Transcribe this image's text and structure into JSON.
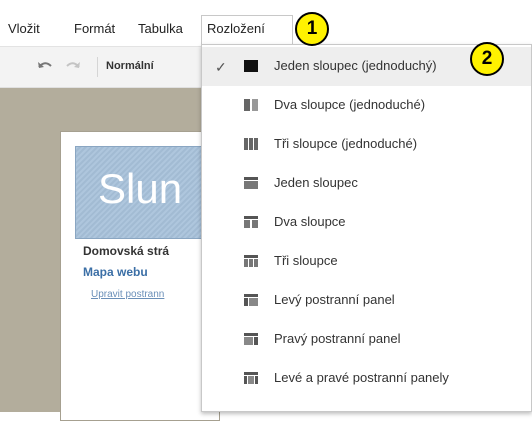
{
  "menubar": {
    "items": [
      {
        "label": "Vložit"
      },
      {
        "label": "Formát"
      },
      {
        "label": "Tabulka"
      },
      {
        "label": "Rozložení"
      }
    ]
  },
  "toolbar": {
    "undo_icon": "undo-icon",
    "redo_icon": "redo-icon",
    "style_value": "Normální"
  },
  "page": {
    "header_title": "Slun",
    "nav_home": "Domovská strá",
    "nav_sitemap": "Mapa webu",
    "nav_edit": "Upravit postrann"
  },
  "layout_menu": {
    "options": [
      {
        "label": "Jeden sloupec (jednoduchý)",
        "icon": "single-column-simple-icon",
        "checked": true
      },
      {
        "label": "Dva sloupce (jednoduché)",
        "icon": "two-columns-simple-icon",
        "checked": false
      },
      {
        "label": "Tři sloupce (jednoduché)",
        "icon": "three-columns-simple-icon",
        "checked": false
      },
      {
        "label": "Jeden sloupec",
        "icon": "single-column-icon",
        "checked": false
      },
      {
        "label": "Dva sloupce",
        "icon": "two-columns-icon",
        "checked": false
      },
      {
        "label": "Tři sloupce",
        "icon": "three-columns-icon",
        "checked": false
      },
      {
        "label": "Levý postranní panel",
        "icon": "left-sidebar-icon",
        "checked": false
      },
      {
        "label": "Pravý postranní panel",
        "icon": "right-sidebar-icon",
        "checked": false
      },
      {
        "label": "Levé a pravé postranní panely",
        "icon": "left-right-sidebars-icon",
        "checked": false
      }
    ],
    "check_mark": "✓"
  },
  "callouts": [
    "1",
    "2"
  ],
  "colors": {
    "callout_fill": "#fff200",
    "selected_row": "#eeeeee",
    "link_blue": "#3b6fa6"
  }
}
